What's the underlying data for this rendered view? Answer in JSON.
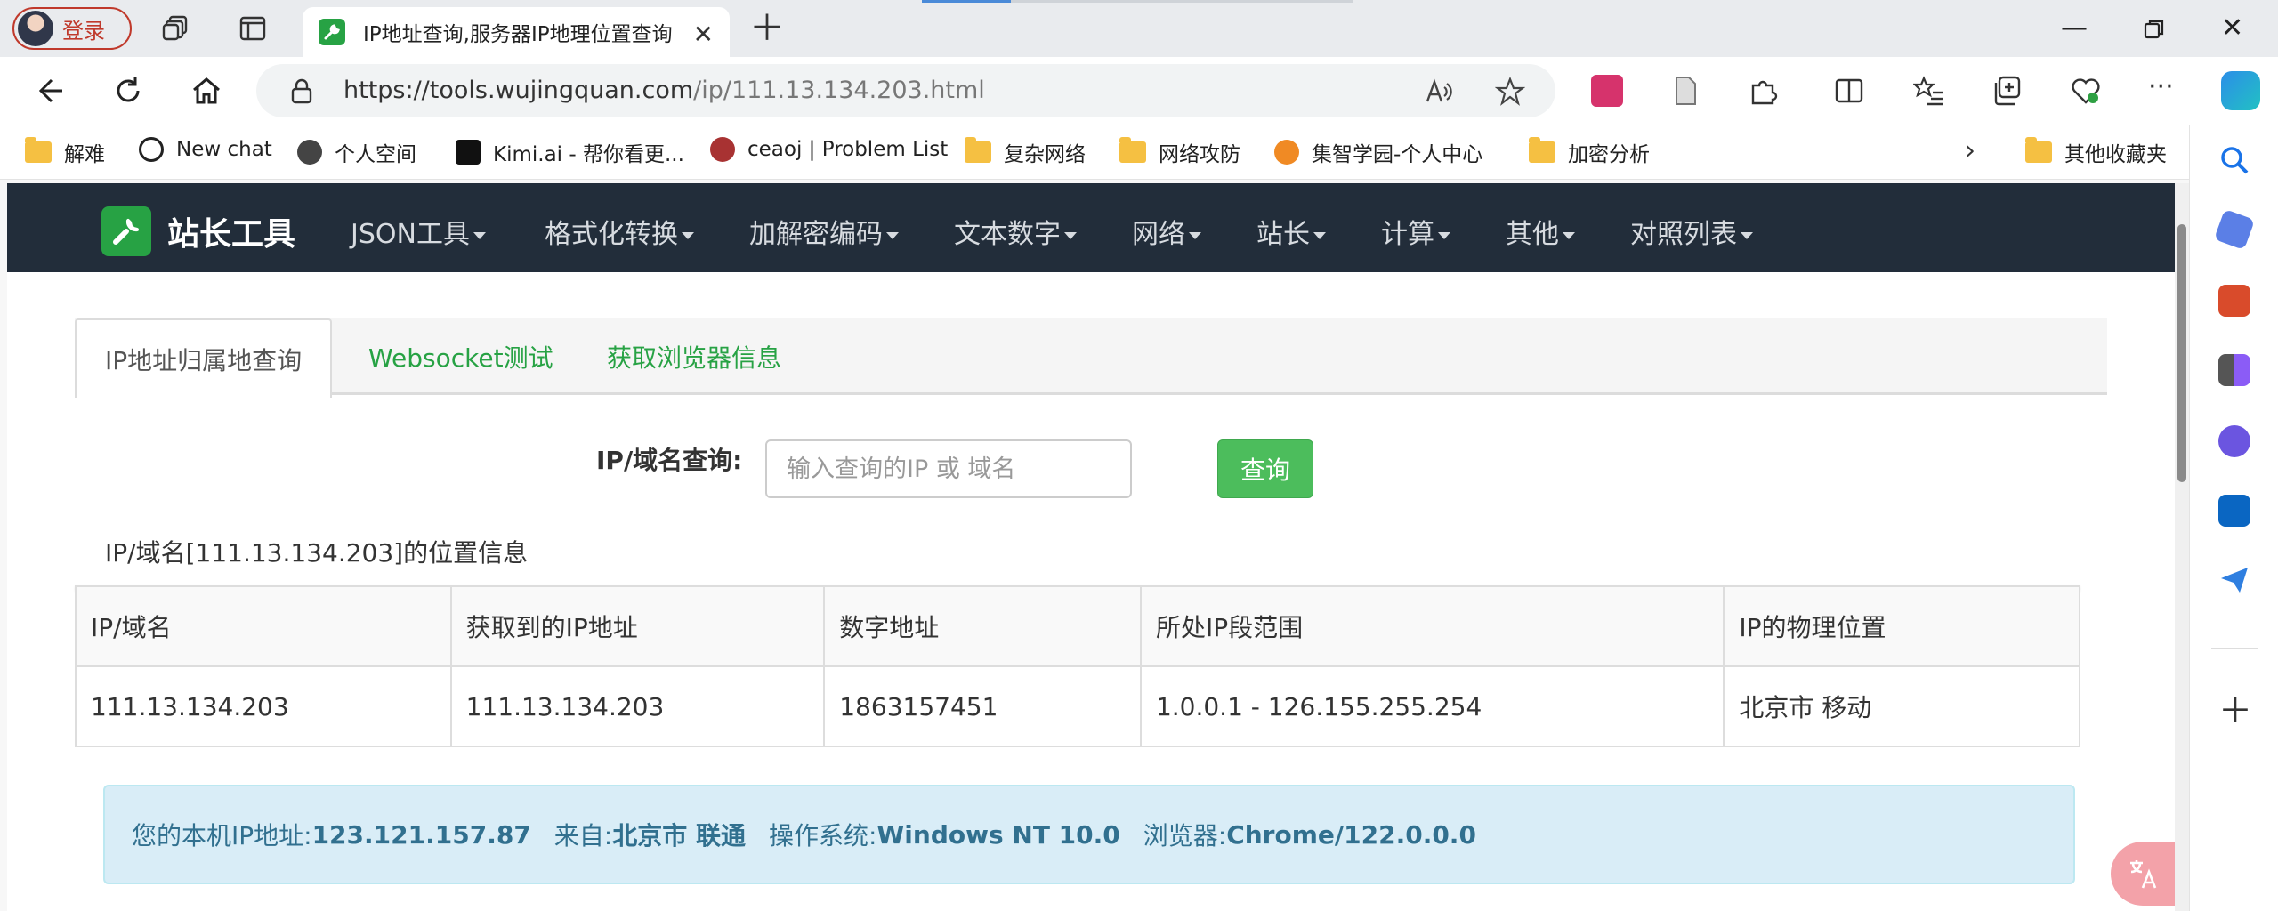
{
  "browser": {
    "login_label": "登录",
    "tab_title": "IP地址查询,服务器IP地理位置查询",
    "url_host": "https://tools.wujingquan.com",
    "url_path": "/ip/111.13.134.203.html"
  },
  "bookmarks": [
    {
      "label": "解难"
    },
    {
      "label": "New chat"
    },
    {
      "label": "个人空间"
    },
    {
      "label": "Kimi.ai - 帮你看更..."
    },
    {
      "label": "ceaoj | Problem List"
    },
    {
      "label": "复杂网络"
    },
    {
      "label": "网络攻防"
    },
    {
      "label": "集智学园-个人中心"
    },
    {
      "label": "加密分析"
    },
    {
      "label": "其他收藏夹"
    }
  ],
  "site": {
    "brand": "站长工具",
    "menu": [
      "JSON工具",
      "格式化转换",
      "加解密编码",
      "文本数字",
      "网络",
      "站长",
      "计算",
      "其他",
      "对照列表"
    ]
  },
  "tabs": [
    "IP地址归属地查询",
    "Websocket测试",
    "获取浏览器信息"
  ],
  "query": {
    "label": "IP/域名查询:",
    "placeholder": "输入查询的IP 或 域名",
    "button": "查询"
  },
  "result": {
    "title": "IP/域名[111.13.134.203]的位置信息",
    "headers": [
      "IP/域名",
      "获取到的IP地址",
      "数字地址",
      "所处IP段范围",
      "IP的物理位置"
    ],
    "row": [
      "111.13.134.203",
      "111.13.134.203",
      "1863157451",
      "1.0.0.1 - 126.155.255.254",
      "北京市 移动"
    ]
  },
  "info": {
    "local_ip_label": "您的本机IP地址:",
    "local_ip": "123.121.157.87",
    "from_label": "来自:",
    "from": "北京市 联通",
    "os_label": "操作系统:",
    "os": "Windows NT 10.0",
    "browser_label": "浏览器:",
    "browser": "Chrome/122.0.0.0"
  },
  "colors": {
    "navbar": "#222d3a",
    "accent_green": "#27a244",
    "query_button": "#4cbd5c",
    "info_bg": "#d9edf7",
    "info_text": "#31708f"
  }
}
